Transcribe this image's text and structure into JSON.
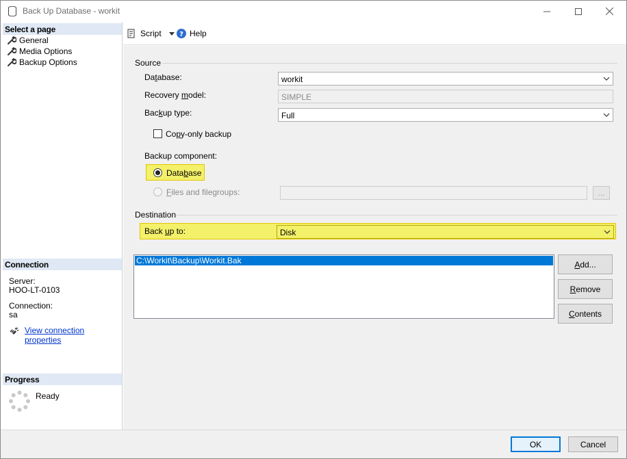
{
  "window": {
    "title": "Back Up Database - workit"
  },
  "left_pane": {
    "select_page_header": "Select a page",
    "pages": [
      "General",
      "Media Options",
      "Backup Options"
    ],
    "connection_header": "Connection",
    "server_label": "Server:",
    "server_value": "HOO-LT-0103",
    "connection_label": "Connection:",
    "connection_value": "sa",
    "view_connection_properties": "View connection properties",
    "progress_header": "Progress",
    "progress_status": "Ready"
  },
  "toolbar": {
    "script_label": "Script",
    "help_label": "Help"
  },
  "source": {
    "group_title": "Source",
    "database_label_pre": "Da",
    "database_label_u": "t",
    "database_label_post": "abase:",
    "database_value": "workit",
    "recovery_label_pre": "Recovery ",
    "recovery_label_u": "m",
    "recovery_label_post": "odel:",
    "recovery_value": "SIMPLE",
    "backup_type_label_pre": "Bac",
    "backup_type_label_u": "k",
    "backup_type_label_post": "up type:",
    "backup_type_value": "Full",
    "copy_only_pre": "Co",
    "copy_only_u": "p",
    "copy_only_post": "y-only backup",
    "copy_only_checked": false,
    "component_label": "Backup component:",
    "database_radio_pre": "Data",
    "database_radio_u": "b",
    "database_radio_post": "ase",
    "files_radio_pre": "",
    "files_radio_u": "F",
    "files_radio_post": "iles and filegroups:",
    "files_browse": "...",
    "selected_component": "Database"
  },
  "destination": {
    "group_title": "Destination",
    "back_up_to_pre": "Back ",
    "back_up_to_u": "u",
    "back_up_to_post": "p to:",
    "back_up_to_value": "Disk",
    "paths": [
      "C:\\Workit\\Backup\\Workit.Bak"
    ],
    "add_pre": "",
    "add_u": "A",
    "add_post": "dd...",
    "remove_pre": "",
    "remove_u": "R",
    "remove_post": "emove",
    "contents_pre": "",
    "contents_u": "C",
    "contents_post": "ontents"
  },
  "footer": {
    "ok_label": "OK",
    "cancel_label": "Cancel"
  },
  "colors": {
    "highlight": "#f3f06a",
    "selection": "#0078d7",
    "link": "#0033cc",
    "pane_header": "#dfe8f4"
  },
  "icons": [
    "database-icon",
    "minimize-icon",
    "maximize-icon",
    "close-icon",
    "wrench-icon",
    "plug-icon",
    "spinner-icon",
    "script-icon",
    "help-icon",
    "chevron-down-icon"
  ]
}
